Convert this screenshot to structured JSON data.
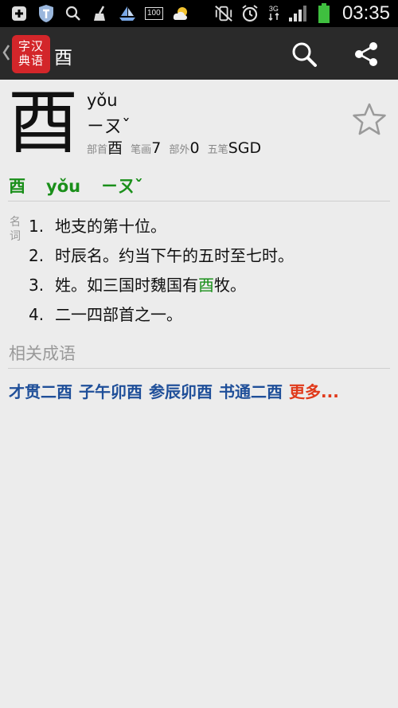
{
  "status_bar": {
    "icons_left": [
      "plus-box-icon",
      "shield-icon",
      "search-icon",
      "broom-icon",
      "boat-icon",
      "storage-100-icon",
      "weather-icon"
    ],
    "storage_label": "100",
    "icons_right": [
      "vibrate-off-icon",
      "alarm-icon",
      "network-3g-icon",
      "signal-icon",
      "battery-icon"
    ],
    "network": "3G",
    "time": "03:35",
    "colors": {
      "battery": "#3fbf3f"
    }
  },
  "action_bar": {
    "logo_text": [
      "字汉",
      "典语"
    ],
    "title": "酉",
    "buttons": [
      "search-icon",
      "share-icon"
    ]
  },
  "entry": {
    "character": "酉",
    "pinyin": "yǒu",
    "zhuyin": "ㄧㄡˇ",
    "radical_label": "部首",
    "radical": "酉",
    "strokes_label": "笔画",
    "strokes": "7",
    "extra_label": "部外",
    "extra_strokes": "0",
    "wubi_label": "五笔",
    "wubi": "SGD",
    "favorite": false
  },
  "pronunciation": {
    "character": "酉",
    "pinyin": "yǒu",
    "zhuyin": "ㄧㄡˇ"
  },
  "definitions": {
    "pos": "名词",
    "items": [
      {
        "num": "1.",
        "text": "地支的第十位。"
      },
      {
        "num": "2.",
        "text": "时辰名。约当下午的五时至七时。"
      },
      {
        "num": "3.",
        "before": "姓。如三国时魏国有",
        "highlight": "酉",
        "after": "牧。"
      },
      {
        "num": "4.",
        "text": "二一四部首之一。"
      }
    ]
  },
  "related": {
    "title": "相关成语",
    "idioms": [
      "才贯二酉",
      "子午卯酉",
      "参辰卯酉",
      "书通二酉"
    ],
    "more": "更多..."
  },
  "colors": {
    "accent_green": "#1a8f1a",
    "link_blue": "#1f4f99",
    "more_orange": "#e0391a",
    "logo_red": "#d3262a"
  }
}
